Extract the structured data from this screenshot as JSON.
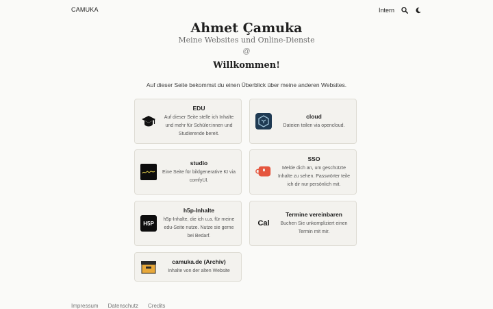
{
  "header": {
    "brand": "CAMUKA",
    "intern_link": "Intern",
    "search_icon": "search-icon",
    "theme_icon": "moon-icon"
  },
  "hero": {
    "name": "Ahmet Çamuka",
    "subtitle": "Meine Websites und Online-Dienste",
    "at_symbol": "@",
    "welcome": "Willkommen!",
    "intro": "Auf dieser Seite bekommst du einen Überblick über meine anderen Websites."
  },
  "cards": [
    {
      "title": "EDU",
      "description": "Auf dieser Seite stelle ich Inhalte und mehr für Schüler:innen und Studierende bereit.",
      "icon": "graduation-cap-icon"
    },
    {
      "title": "cloud",
      "description": "Dateien teilen via opencloud.",
      "icon": "cloud-logo-icon"
    },
    {
      "title": "studio",
      "description": "Eine Seite für bildgenerative KI via comfyUI.",
      "icon": "studio-logo-icon"
    },
    {
      "title": "SSO",
      "description": "Melde dich an, um geschützte Inhalte zu sehen. Passwörter teile ich dir nur persönlich mit.",
      "icon": "sso-logo-icon"
    },
    {
      "title": "h5p-Inhalte",
      "description": "h5p-Inhalte, die ich u.a. für meine edu-Seite nutze. Nutze sie gerne bei Bedarf.",
      "icon": "h5p-logo-icon",
      "icon_text": "H5P"
    },
    {
      "title": "Termine vereinbaren",
      "description": "Buchen Sie unkompliziert einen Termin mit mir.",
      "icon": "cal-logo-icon",
      "icon_text": "Cal"
    },
    {
      "title": "camuka.de (Archiv)",
      "description": "Inhalte von der alten Website",
      "icon": "archive-box-icon"
    }
  ],
  "footer": {
    "links": [
      "Impressum",
      "Datenschutz",
      "Credits"
    ]
  }
}
